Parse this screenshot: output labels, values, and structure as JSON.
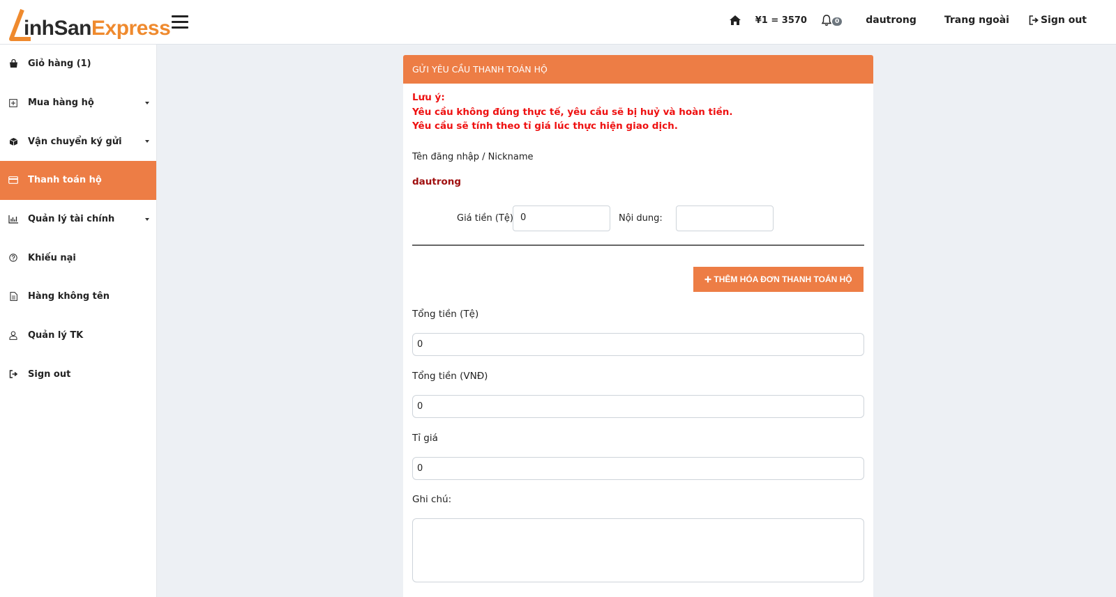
{
  "brand": {
    "logo_dark": "inhSan",
    "logo_orange": "Express"
  },
  "header": {
    "exchange_rate": "¥1 = 3570",
    "notification_count": "0",
    "username": "dautrong",
    "outside_link": "Trang ngoài",
    "signout": "Sign out"
  },
  "sidebar": {
    "items": [
      {
        "label": "Giỏ hàng (1)",
        "icon": "shopping-bag-icon"
      },
      {
        "label": "Mua hàng hộ",
        "icon": "plus-square-icon",
        "has_dropdown": true
      },
      {
        "label": "Vận chuyển ký gửi",
        "icon": "box-icon",
        "has_dropdown": true
      },
      {
        "label": "Thanh toán hộ",
        "icon": "credit-card-icon",
        "active": true
      },
      {
        "label": "Quản lý tài chính",
        "icon": "bar-chart-icon",
        "has_dropdown": true
      },
      {
        "label": "Khiếu nại",
        "icon": "question-circle-icon"
      },
      {
        "label": "Hàng không tên",
        "icon": "document-icon"
      },
      {
        "label": "Quản lý TK",
        "icon": "user-icon"
      },
      {
        "label": "Sign out",
        "icon": "sign-out-icon"
      }
    ]
  },
  "form": {
    "title": "GỬI YÊU CẦU THANH TOÁN HỘ",
    "notice_title": "Lưu ý:",
    "notice_line1": "Yêu cầu không đúng thực tế, yêu cầu sẽ bị huỷ và hoàn tiền.",
    "notice_line2": "Yêu cầu sẽ tính theo tỉ giá lúc thực hiện giao dịch.",
    "nickname_label": "Tên đăng nhập / Nickname",
    "nickname_value": "dautrong",
    "price_label": "Giá tiền (Tệ):",
    "price_value": "0",
    "content_label": "Nội dung:",
    "content_value": "",
    "add_button": "THÊM HÓA ĐƠN THANH TOÁN HỘ",
    "total_cny_label": "Tổng tiền (Tệ)",
    "total_cny_value": "0",
    "total_vnd_label": "Tổng tiền (VNĐ)",
    "total_vnd_value": "0",
    "rate_label": "Tỉ giá",
    "rate_value": "0",
    "note_label": "Ghi chú:",
    "note_value": ""
  },
  "colors": {
    "accent": "#ed7d45",
    "notice": "#e11111",
    "nickname": "#a01010"
  }
}
